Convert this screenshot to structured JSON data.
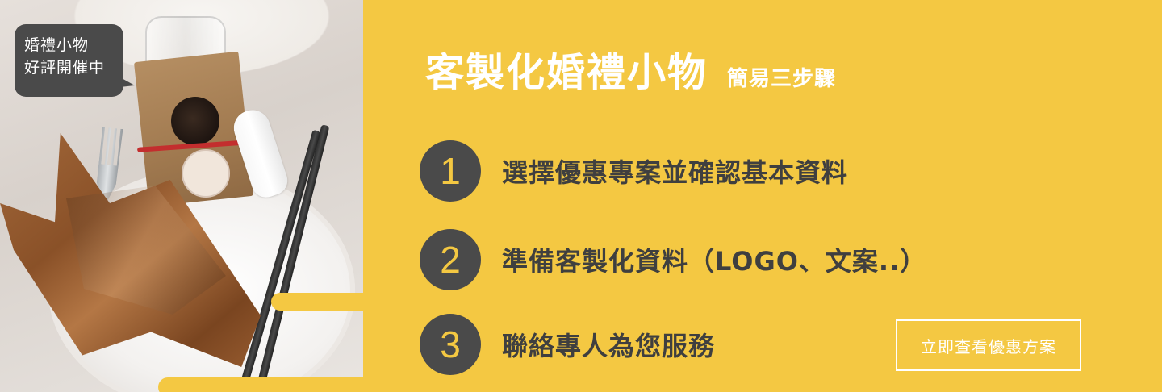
{
  "badge": {
    "line1": "婚禮小物",
    "line2": "好評開催中"
  },
  "header": {
    "title": "客製化婚禮小物",
    "subtitle": "簡易三步驟"
  },
  "steps": [
    {
      "number": "1",
      "text": "選擇優惠專案並確認基本資料"
    },
    {
      "number": "2",
      "text": "準備客製化資料（LOGO、文案..）"
    },
    {
      "number": "3",
      "text": "聯絡專人為您服務"
    }
  ],
  "cta": {
    "label": "立即查看優惠方案"
  },
  "colors": {
    "background": "#f4c842",
    "dark": "#4a4a4a",
    "text_dark": "#3f3f3f",
    "white": "#ffffff"
  }
}
